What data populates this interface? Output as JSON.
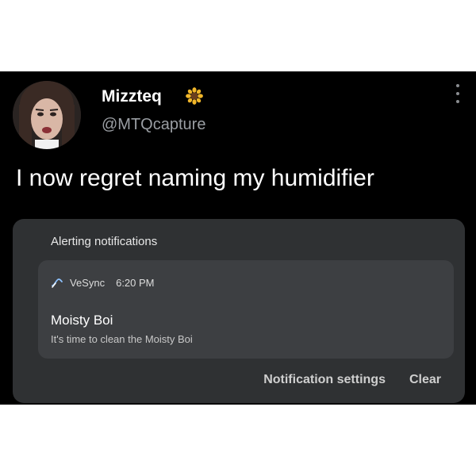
{
  "tweet": {
    "display_name": "Mizzteq",
    "name_emoji_icon": "sunflower-icon",
    "handle": "@MTQcapture",
    "text": "I now regret naming my humidifier"
  },
  "notification_panel": {
    "header": "Alerting notifications",
    "notification": {
      "app_icon": "vesync-icon",
      "app_name": "VeSync",
      "time": "6:20 PM",
      "title": "Moisty Boi",
      "body": "It's time to clean the Moisty Boi"
    },
    "actions": {
      "settings_label": "Notification settings",
      "clear_label": "Clear"
    }
  },
  "colors": {
    "tweet_background": "#000000",
    "panel_background": "#2f3133",
    "card_background": "#3d3f42",
    "handle_gray": "#9a9ea3"
  }
}
